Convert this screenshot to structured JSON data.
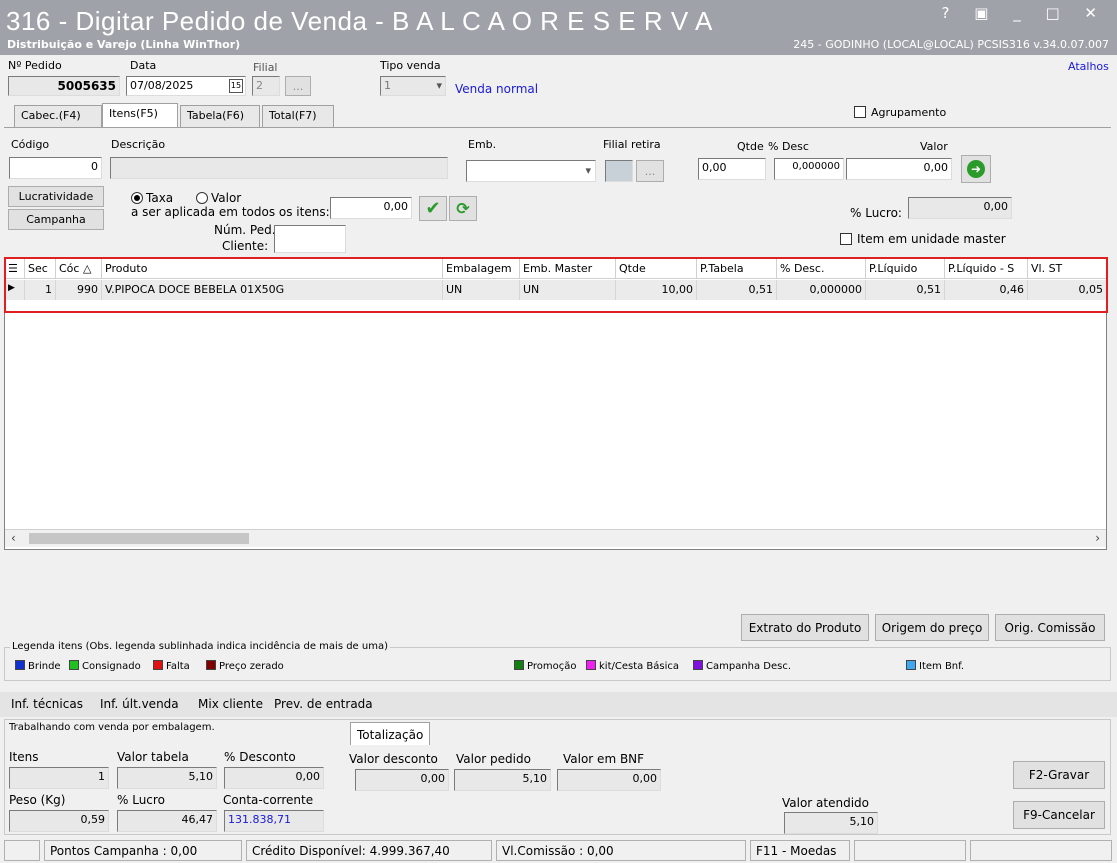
{
  "window": {
    "title": "316 - Digitar Pedido de Venda - B A L C A O  R E S E R V A",
    "subtitle": "Distribuição e Varejo (Linha WinThor)",
    "session": "245 - GODINHO (LOCAL@LOCAL)   PCSIS316  v.34.0.07.007",
    "controls": "? ▣ _ □ ✕"
  },
  "header": {
    "pedido_label": "Nº Pedido",
    "pedido_value": "5005635",
    "data_label": "Data",
    "data_value": "07/08/2025",
    "calendar_icon": "15",
    "filial_label": "Filial",
    "filial_value": "2",
    "filial_btn": "...",
    "tipo_label": "Tipo venda",
    "tipo_value": "1",
    "tipo_desc": "Venda normal",
    "atalhos": "Atalhos"
  },
  "tabs": [
    "Cabec.(F4)",
    "Itens(F5)",
    "Tabela(F6)",
    "Total(F7)"
  ],
  "agrupamento": "Agrupamento",
  "item": {
    "codigo_label": "Código",
    "codigo_value": "0",
    "descricao_label": "Descrição",
    "emb_label": "Emb.",
    "filial_retira_label": "Filial retira",
    "filial_retira_btn": "...",
    "qtde_label": "Qtde",
    "desc_label": "% Desc",
    "valor_label": "Valor",
    "qtde_value": "0,00",
    "desc_value": "0,000000",
    "valor_value": "0,00",
    "lucratividade_btn": "Lucratividade",
    "campanha_btn": "Campanha",
    "taxa_label": "Taxa",
    "valor_radio_label": "Valor",
    "aplicada_label": "a ser aplicada em todos os itens:",
    "taxa_value": "0,00",
    "num_ped_label": "Núm. Ped.",
    "cliente_label": "Cliente:",
    "lucro_label": "% Lucro:",
    "lucro_value": "0,00",
    "unidade_master_label": "Item em unidade master"
  },
  "grid": {
    "columns": [
      "Sec",
      "Cóc △",
      "Produto",
      "Embalagem",
      "Emb. Master",
      "Qtde",
      "P.Tabela",
      "% Desc.",
      "P.Líquido",
      "P.Líquido - S",
      "Vl. ST"
    ],
    "rows": [
      [
        "1",
        "990",
        "V.PIPOCA DOCE BEBELA 01X50G",
        "UN",
        "UN",
        "10,00",
        "0,51",
        "0,000000",
        "0,51",
        "0,46",
        "0,05"
      ]
    ]
  },
  "buttons": {
    "extrato": "Extrato do Produto",
    "origem": "Origem do preço",
    "comissao": "Orig. Comissão",
    "gravar": "F2-Gravar",
    "cancelar": "F9-Cancelar"
  },
  "legend": {
    "title": "Legenda itens (Obs. legenda sublinhada indica incidência de mais de uma)",
    "items": [
      {
        "label": "Brinde",
        "color": "#1030d0"
      },
      {
        "label": "Consignado",
        "color": "#20c020"
      },
      {
        "label": "Falta",
        "color": "#e01010"
      },
      {
        "label": "Preço zerado",
        "color": "#800000"
      },
      {
        "label": "Promoção",
        "color": "#108010"
      },
      {
        "label": "kit/Cesta Básica",
        "color": "#f020f0"
      },
      {
        "label": "Campanha Desc.",
        "color": "#8010e0"
      },
      {
        "label": "Item Bnf.",
        "color": "#40a8f0"
      }
    ]
  },
  "links": [
    "Inf. técnicas",
    "Inf. últ.venda",
    "Mix cliente",
    "Prev. de entrada"
  ],
  "totals": {
    "info": "Trabalhando com venda por embalagem.",
    "tab": "Totalização",
    "itens_label": "Itens",
    "itens_value": "1",
    "valor_tabela_label": "Valor tabela",
    "valor_tabela_value": "5,10",
    "desconto_label": "% Desconto",
    "desconto_value": "0,00",
    "valor_desconto_label": "Valor desconto",
    "valor_desconto_value": "0,00",
    "valor_pedido_label": "Valor pedido",
    "valor_pedido_value": "5,10",
    "valor_bnf_label": "Valor em BNF",
    "valor_bnf_value": "0,00",
    "peso_label": "Peso (Kg)",
    "peso_value": "0,59",
    "lucro_label": "% Lucro",
    "lucro_value": "46,47",
    "conta_label": "Conta-corrente",
    "conta_value": "131.838,71",
    "atendido_label": "Valor atendido",
    "atendido_value": "5,10"
  },
  "status": {
    "pontos": "Pontos Campanha : 0,00",
    "credito": "Crédito Disponível: 4.999.367,40",
    "comissao": "Vl.Comissão : 0,00",
    "moedas": "F11 - Moedas"
  },
  "colors": {
    "titlebar": "#9fa2a8",
    "highlight": "#e02020",
    "link": "#1a1ad8"
  }
}
